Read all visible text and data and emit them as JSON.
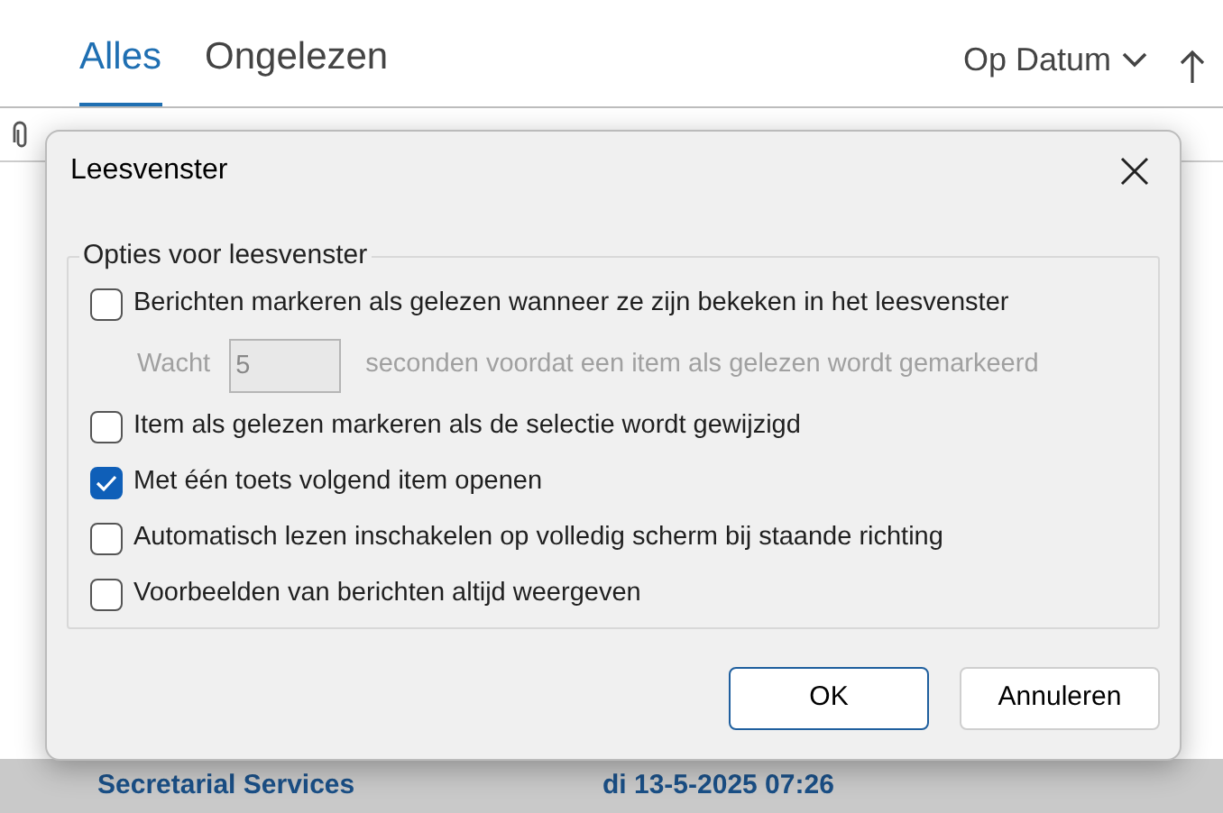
{
  "tabs": [
    {
      "label": "Alles",
      "selected": true
    },
    {
      "label": "Ongelezen",
      "selected": false
    }
  ],
  "sort": {
    "label": "Op Datum"
  },
  "list_row": {
    "sender": "Secretarial Services",
    "date": "di 13-5-2025 07:26"
  },
  "dialog": {
    "title": "Leesvenster",
    "group_title": "Opties voor leesvenster",
    "options": [
      {
        "kind": "checkbox",
        "label": "Berichten markeren als gelezen wanneer ze zijn bekeken in het leesvenster",
        "checked": false
      },
      {
        "kind": "delay",
        "label": "Wacht",
        "value": "5",
        "suffix": "seconden voordat een item als gelezen wordt gemarkeerd",
        "disabled": true
      },
      {
        "kind": "checkbox",
        "label": "Item als gelezen markeren als de selectie wordt gewijzigd",
        "checked": false
      },
      {
        "kind": "checkbox",
        "label": "Met één toets volgend item openen",
        "checked": true
      },
      {
        "kind": "checkbox",
        "label": "Automatisch lezen inschakelen op volledig scherm bij staande richting",
        "checked": false
      },
      {
        "kind": "checkbox",
        "label": "Voorbeelden van berichten altijd weergeven",
        "checked": false
      }
    ],
    "buttons": [
      {
        "label": "OK",
        "kind": "primary"
      },
      {
        "label": "Annuleren",
        "kind": "secondary"
      }
    ]
  }
}
